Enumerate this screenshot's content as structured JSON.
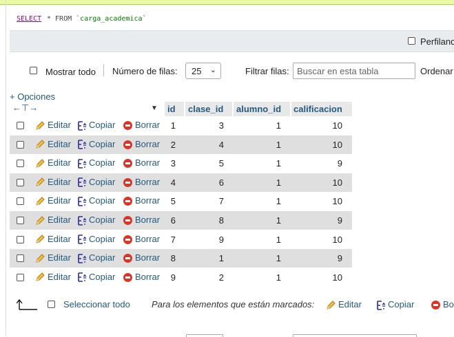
{
  "query": {
    "keyword": "SELECT",
    "rest": " * FROM ",
    "table": "`carga_academica`"
  },
  "profiling": {
    "label": "Perfilando"
  },
  "toolbar": {
    "show_all": "Mostrar todo",
    "rows_label": "Número de filas:",
    "rows_value": "25",
    "filter_label": "Filtrar filas:",
    "filter_placeholder": "Buscar en esta tabla",
    "order_label": "Ordenar"
  },
  "options_link": "+ Opciones",
  "columns": [
    "id",
    "clase_id",
    "alumno_id",
    "calificacion"
  ],
  "actions": {
    "edit": "Editar",
    "copy": "Copiar",
    "delete": "Borrar"
  },
  "rows": [
    {
      "id": "1",
      "clase_id": "3",
      "alumno_id": "1",
      "calificacion": "10"
    },
    {
      "id": "2",
      "clase_id": "4",
      "alumno_id": "1",
      "calificacion": "10"
    },
    {
      "id": "3",
      "clase_id": "5",
      "alumno_id": "1",
      "calificacion": "9"
    },
    {
      "id": "4",
      "clase_id": "6",
      "alumno_id": "1",
      "calificacion": "10"
    },
    {
      "id": "5",
      "clase_id": "7",
      "alumno_id": "1",
      "calificacion": "10"
    },
    {
      "id": "6",
      "clase_id": "8",
      "alumno_id": "1",
      "calificacion": "9"
    },
    {
      "id": "7",
      "clase_id": "9",
      "alumno_id": "1",
      "calificacion": "10"
    },
    {
      "id": "8",
      "clase_id": "1",
      "alumno_id": "1",
      "calificacion": "9"
    },
    {
      "id": "9",
      "clase_id": "2",
      "alumno_id": "1",
      "calificacion": "10"
    }
  ],
  "footer": {
    "select_all": "Seleccionar todo",
    "marked_text": "Para los elementos que están marcados:",
    "edit": "Editar",
    "copy": "Copiar",
    "delete": "Bo"
  },
  "colors": {
    "link": "#235a81",
    "even_row": "#dfdfdf",
    "delete_red": "#d9362a",
    "success_bar": "#ebf8a4"
  }
}
